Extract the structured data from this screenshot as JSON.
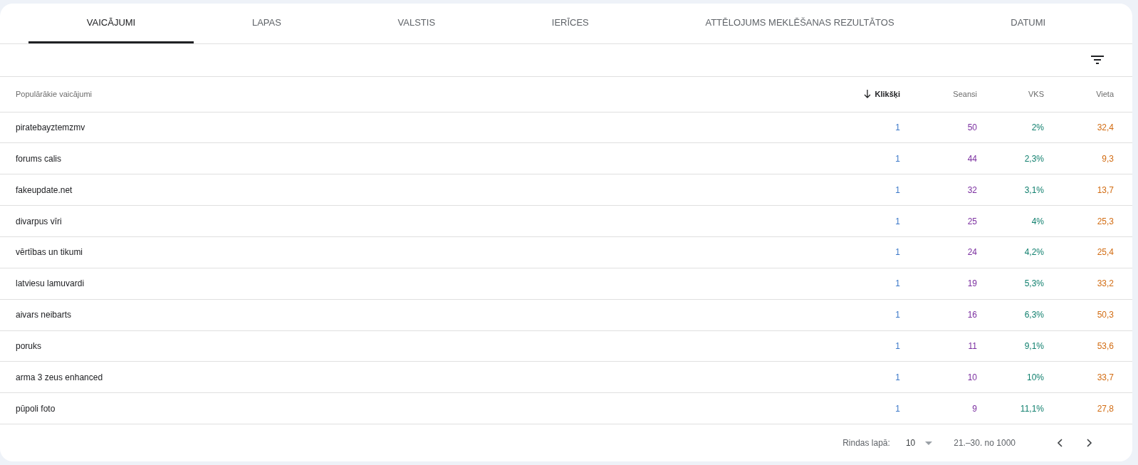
{
  "tabs": [
    {
      "label": "VAICĀJUMI",
      "selected": true
    },
    {
      "label": "LAPAS",
      "selected": false
    },
    {
      "label": "VALSTIS",
      "selected": false
    },
    {
      "label": "IERĪCES",
      "selected": false
    },
    {
      "label": "ATTĒLOJUMS MEKLĒŠANAS REZULTĀTOS",
      "selected": false
    },
    {
      "label": "DATUMI",
      "selected": false
    }
  ],
  "table": {
    "columns": [
      {
        "label": "Populārākie vaicājumi",
        "sorted": false
      },
      {
        "label": "Klikšķi",
        "sorted": true,
        "color": "#3b78c9"
      },
      {
        "label": "Seansi",
        "sorted": false,
        "color": "#7b2fa0"
      },
      {
        "label": "VKS",
        "sorted": false,
        "color": "#12806f"
      },
      {
        "label": "Vieta",
        "sorted": false,
        "color": "#d26c12"
      }
    ],
    "rows": [
      [
        "piratebayztemzmv",
        "1",
        "50",
        "2%",
        "32,4"
      ],
      [
        "forums calis",
        "1",
        "44",
        "2,3%",
        "9,3"
      ],
      [
        "fakeupdate.net",
        "1",
        "32",
        "3,1%",
        "13,7"
      ],
      [
        "divarpus vīri",
        "1",
        "25",
        "4%",
        "25,3"
      ],
      [
        "vērtības un tikumi",
        "1",
        "24",
        "4,2%",
        "25,4"
      ],
      [
        "latviesu lamuvardi",
        "1",
        "19",
        "5,3%",
        "33,2"
      ],
      [
        "aivars neibarts",
        "1",
        "16",
        "6,3%",
        "50,3"
      ],
      [
        "poruks",
        "1",
        "11",
        "9,1%",
        "53,6"
      ],
      [
        "arma 3 zeus enhanced",
        "1",
        "10",
        "10%",
        "33,7"
      ],
      [
        "pūpoli foto",
        "1",
        "9",
        "11,1%",
        "27,8"
      ]
    ]
  },
  "pagination": {
    "rows_label": "Rindas lapā:",
    "rows_value": "10",
    "range": "21.–30. no 1000"
  }
}
